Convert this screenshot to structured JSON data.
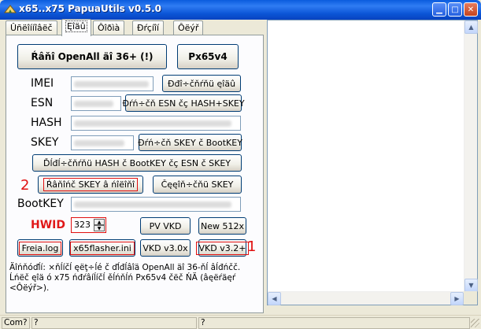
{
  "window": {
    "title": "x65..x75 PapuaUtils v0.5.0"
  },
  "tabs": [
    "Ûñëîííîâëč",
    "Ęîäû",
    "Ôîðìà",
    "Ðŕçíîí",
    "Ôëýř"
  ],
  "active_tab_index": 1,
  "buttons": {
    "unlock": "Ŕâňî OpenAll äî 36+ (!)",
    "px65v4": "Px65v4",
    "calc_code": "Đđî÷čňŕňü ęîäû",
    "calc_esn": "Đŕń÷čň ESN čç HASH+SKEY",
    "calc_skey": "Đŕń÷čň SKEY č BootKEY",
    "calc_all": "Ďĺđĺ÷čňŕňü HASH č BootKEY čç ESN č SKEY",
    "save_skey": "Ŕâňîńč SKEY â ńîëîňî",
    "get_skey": "Čęęîň÷čňü SKEY",
    "pv_vkd": "PV VKD",
    "new_512": "New 512x",
    "freia": "Freia.log",
    "x65flasher": "x65flasher.ini",
    "vkd30": "VKD v3.0x",
    "vkd32": "VKD v3.2+"
  },
  "labels": {
    "imei": "IMEI",
    "esn": "ESN",
    "hash": "HASH",
    "skey": "SKEY",
    "bootkey": "BootKEY",
    "hwid": "HWID"
  },
  "hwid_value": "323",
  "annotations": {
    "one": "1",
    "two": "2"
  },
  "hint": "Äîńňóďĺí: ×ňĺíčĺ ęëţ÷ĺé č ďĺđĺâîä OpenAll äî 36-ňĺ âĺđńčč. Ĺńëč ęîä ó x75 ńđŕâíĺíčĺ ěĺńňĺń Px65v4 čëč ŃÄ (âęëŕäęŕ <Ôëýř>).",
  "status": {
    "port": "Com?",
    "pane2": "?",
    "pane3": "?"
  }
}
